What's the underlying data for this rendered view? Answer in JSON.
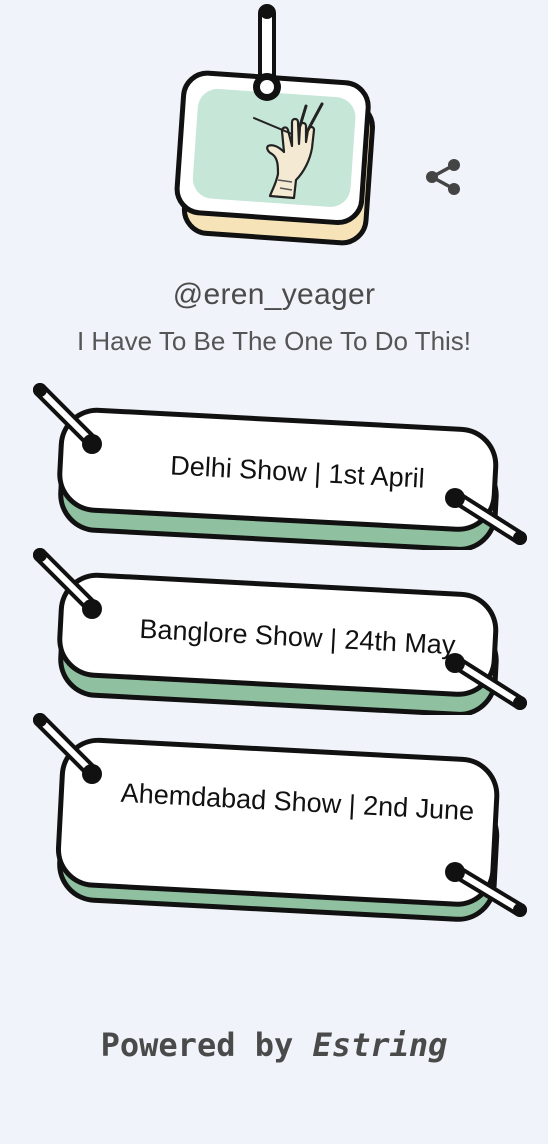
{
  "profile": {
    "handle": "@eren_yeager",
    "bio": "I Have To Be The One To Do This!",
    "avatar_icon": "hand-gesture-icon",
    "avatar_bg": "#c6e6d8",
    "card_shadow_color": "#f7e3b8"
  },
  "share": {
    "icon": "share-icon"
  },
  "links": [
    {
      "label": "Delhi Show | 1st April"
    },
    {
      "label": "Banglore Show | 24th May"
    },
    {
      "label": "Ahemdabad Show | 2nd June"
    }
  ],
  "link_shadow_color": "#8fc0a0",
  "footer": {
    "prefix": "Powered by ",
    "brand": "Estring"
  }
}
